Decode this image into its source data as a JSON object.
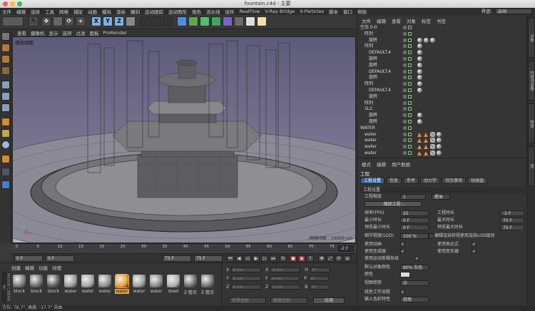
{
  "window": {
    "title": "fountain.c4d - 主要"
  },
  "menubar": {
    "items": [
      "文件",
      "编辑",
      "选择",
      "工具",
      "网格",
      "捕捉",
      "动画",
      "模拟",
      "渲染",
      "雕刻",
      "运动跟踪",
      "运动图形",
      "角色",
      "流水线",
      "插件",
      "RealFlow",
      "V-Ray Bridge",
      "X-Particles",
      "脚本",
      "窗口",
      "帮助"
    ],
    "layout_label": "界面:",
    "layout_value": "启动"
  },
  "viewport": {
    "menu": [
      "查看",
      "摄像机",
      "显示",
      "选项",
      "过滤",
      "面板",
      "ProRender"
    ],
    "title": "透视视图",
    "grid_spacing": "网格间距 : 10000 cm"
  },
  "toolbar": {
    "axes": [
      "X",
      "Y",
      "Z"
    ]
  },
  "timeline": {
    "ticks": [
      "0",
      "5",
      "10",
      "15",
      "20",
      "25",
      "30",
      "35",
      "40",
      "45",
      "50",
      "55",
      "60",
      "65",
      "70",
      "75"
    ],
    "end_frame": "-2 F"
  },
  "time_controls": {
    "start": "0 F",
    "min": "0 F",
    "max": "75 F",
    "end": "75 F"
  },
  "materials": {
    "menu": [
      "创建",
      "编辑",
      "功能",
      "纹理"
    ],
    "items": [
      {
        "label": "block",
        "color": "#7a7a7a"
      },
      {
        "label": "block",
        "color": "#6d6d6d"
      },
      {
        "label": "block",
        "color": "#5e5e5e"
      },
      {
        "label": "water",
        "color": "#9a9a9a"
      },
      {
        "label": "water",
        "color": "#a5a5a5"
      },
      {
        "label": "water",
        "color": "#8f8f8f"
      },
      {
        "label": "water",
        "color": "#e8a23b"
      },
      {
        "label": "water",
        "color": "#9c9c9c"
      },
      {
        "label": "water",
        "color": "#8a8a8a"
      },
      {
        "label": "steel",
        "color": "#b0b0b0"
      },
      {
        "label": "Z-整合",
        "color": "#6b6b6b"
      },
      {
        "label": "Z-整合",
        "color": "#737373"
      }
    ]
  },
  "coords": {
    "rows": [
      {
        "axis": "X",
        "a": "0 cm",
        "b": "X",
        "c": "0 cm",
        "d": "H",
        "e": "0°"
      },
      {
        "axis": "Y",
        "a": "0 cm",
        "b": "Y",
        "c": "0 cm",
        "d": "P",
        "e": "0°"
      },
      {
        "axis": "Z",
        "a": "0 cm",
        "b": "Z",
        "c": "0 cm",
        "d": "B",
        "e": "0°"
      }
    ],
    "mode": "世界坐标",
    "scale": "缩放比例",
    "apply": "应用"
  },
  "status": {
    "text": "方位: 78.7°, 高度: -17.7° 自由"
  },
  "object_manager": {
    "tabs": [
      "文件",
      "编辑",
      "查看",
      "对象",
      "标签",
      "书签"
    ],
    "rows": [
      {
        "name": "空白 0-0",
        "indent": 0,
        "tags": []
      },
      {
        "name": "阵列",
        "indent": 1,
        "tags": []
      },
      {
        "name": "旋转",
        "indent": 2,
        "tags": [
          "ball",
          "ball",
          "ball"
        ]
      },
      {
        "name": "阵列",
        "indent": 1,
        "tags": [
          "ball"
        ]
      },
      {
        "name": "DEFAULT.4",
        "indent": 2,
        "tags": [
          "ball"
        ]
      },
      {
        "name": "旋转",
        "indent": 2,
        "tags": [
          "ball"
        ]
      },
      {
        "name": "旋转",
        "indent": 2,
        "tags": [
          "ball"
        ]
      },
      {
        "name": "DEFAULT.4",
        "indent": 2,
        "tags": [
          "ball"
        ]
      },
      {
        "name": "旋转",
        "indent": 2,
        "tags": [
          "ball"
        ]
      },
      {
        "name": "阵列",
        "indent": 1,
        "tags": [
          "ball"
        ]
      },
      {
        "name": "DEFAULT.4",
        "indent": 2,
        "tags": [
          "ball"
        ]
      },
      {
        "name": "旋转",
        "indent": 2,
        "tags": []
      },
      {
        "name": "阵列",
        "indent": 1,
        "tags": []
      },
      {
        "name": "以上",
        "indent": 1,
        "tags": []
      },
      {
        "name": "旋转",
        "indent": 2,
        "tags": [
          "ball"
        ]
      },
      {
        "name": "旋转",
        "indent": 2,
        "tags": [
          "ball"
        ]
      },
      {
        "name": "WATER",
        "indent": 0,
        "tags": []
      },
      {
        "name": "water",
        "indent": 1,
        "tags": [
          "tri",
          "tri",
          "sq",
          "ball"
        ]
      },
      {
        "name": "water",
        "indent": 1,
        "tags": [
          "tri",
          "tri",
          "sq",
          "ball"
        ]
      },
      {
        "name": "water",
        "indent": 1,
        "tags": [
          "tri",
          "tri",
          "sq",
          "ball"
        ]
      },
      {
        "name": "water",
        "indent": 1,
        "tags": [
          "tri",
          "tri",
          "sq",
          "ball"
        ]
      }
    ]
  },
  "side_tabs": [
    "对象",
    "内容浏览器",
    "构造",
    "层"
  ],
  "attributes": {
    "menu": [
      "模式",
      "编辑",
      "用户数据"
    ],
    "title": "工程",
    "tabs": [
      "工程设置",
      "信息",
      "参考",
      "动力学",
      "待办事项",
      "帧插值"
    ],
    "section": "工程设置",
    "scale_label": "工程缩放",
    "scale_value": "1",
    "scale_unit": "厘米",
    "scale_button": "缩放工程...",
    "fps_label": "帧率(FPS)",
    "fps_value": "25",
    "min_label": "最小时长",
    "min_value": "0 F",
    "preview_min_label": "预览最小时长",
    "preview_min_value": "0 F",
    "lod_label": "细节程度(LOD)",
    "lod_value": "100 %",
    "doc_time_label": "工程时长",
    "doc_time_value": "-2 F",
    "max_label": "最大时长",
    "max_value": "75 F",
    "preview_max_label": "预览最大时长",
    "preview_max_value": "75 F",
    "render_lod_label": "编辑渲染检视使用渲染LOD级别",
    "use_anim": "使用动画",
    "use_expr": "使用表达式",
    "use_gen": "使用生成器",
    "use_deform": "使用变形器",
    "use_motion": "使用运动剪辑系统",
    "default_color_label": "默认对象颜色",
    "default_color_value": "80% 灰色",
    "color_label": "颜色",
    "view_label": "视图修剪",
    "view_value": "中",
    "linear_label": "线性工作流程",
    "input_label": "输入色彩特性",
    "input_value": "禁用"
  }
}
